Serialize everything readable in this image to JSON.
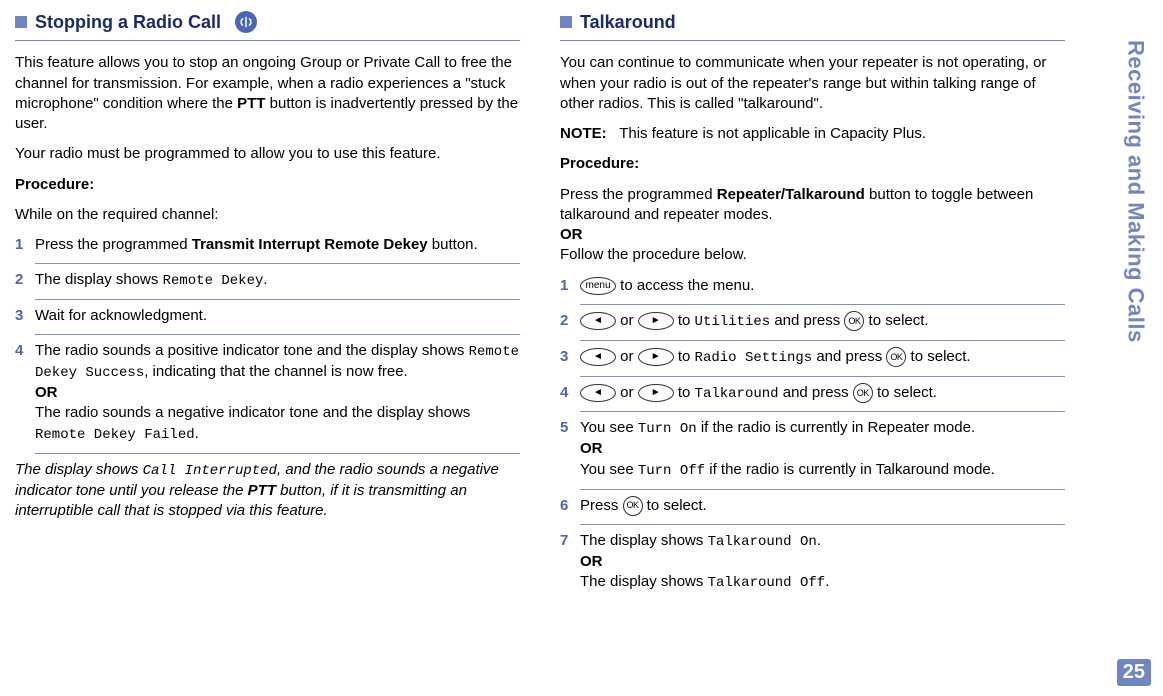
{
  "sidebar": {
    "label": "Receiving and Making Calls",
    "page_number": "25"
  },
  "left": {
    "heading": "Stopping a Radio Call",
    "p1a": "This feature allows you to stop an ongoing Group or Private Call to free the channel for transmission. For example, when a radio experiences a \"stuck microphone\" condition where the ",
    "p1b": "PTT",
    "p1c": " button is inadvertently pressed by the user.",
    "p2": "Your radio must be programmed to allow you to use this feature.",
    "proc_label": "Procedure:",
    "proc_intro": "While on the required channel:",
    "steps": {
      "s1a": "Press the programmed ",
      "s1b": "Transmit Interrupt Remote Dekey",
      "s1c": " button.",
      "s2a": "The display shows ",
      "s2b": "Remote Dekey",
      "s2c": ".",
      "s3": "Wait for acknowledgment.",
      "s4a": "The radio sounds a positive indicator tone and the display shows ",
      "s4b": "Remote Dekey Success",
      "s4c": ", indicating that the channel is now free.",
      "s4or": "OR",
      "s4d": "The radio sounds a negative indicator tone and the display shows ",
      "s4e": "Remote Dekey Failed",
      "s4f": "."
    },
    "note1a": "The display shows ",
    "note1b": "Call Interrupted",
    "note1c": ", and the radio sounds a negative indicator tone until you release the ",
    "note1d": "PTT",
    "note1e": " button, if it is transmitting an interruptible call that is stopped via this feature."
  },
  "right": {
    "heading": "Talkaround",
    "p1": "You can continue to communicate when your repeater is not operating, or when your radio is out of the repeater's range but within talking range of other radios. This is called \"talkaround\".",
    "note_label": "NOTE:",
    "note_text": "This feature is not applicable in Capacity Plus.",
    "proc_label": "Procedure:",
    "proc1a": "Press the programmed ",
    "proc1b": "Repeater/Talkaround",
    "proc1c": " button to toggle between talkaround and repeater modes.",
    "proc_or": "OR",
    "proc2": "Follow the procedure below.",
    "menu_label": "menu",
    "ok_label": "OK",
    "steps": {
      "s1": " to access the menu.",
      "s2a": " or ",
      "s2b": " to ",
      "s2c": "Utilities",
      "s2d": " and press ",
      "s2e": " to select.",
      "s3c": "Radio Settings",
      "s4c": "Talkaround",
      "s5a": "You see ",
      "s5b": "Turn On",
      "s5c": " if the radio is currently in Repeater mode.",
      "s5or": "OR",
      "s5d": "You see ",
      "s5e": "Turn Off",
      "s5f": " if the radio is currently in Talkaround mode.",
      "s6a": "Press ",
      "s6b": " to select.",
      "s7a": "The display shows ",
      "s7b": "Talkaround On",
      "s7c": ".",
      "s7or": "OR",
      "s7d": "The display shows ",
      "s7e": "Talkaround Off",
      "s7f": "."
    }
  }
}
